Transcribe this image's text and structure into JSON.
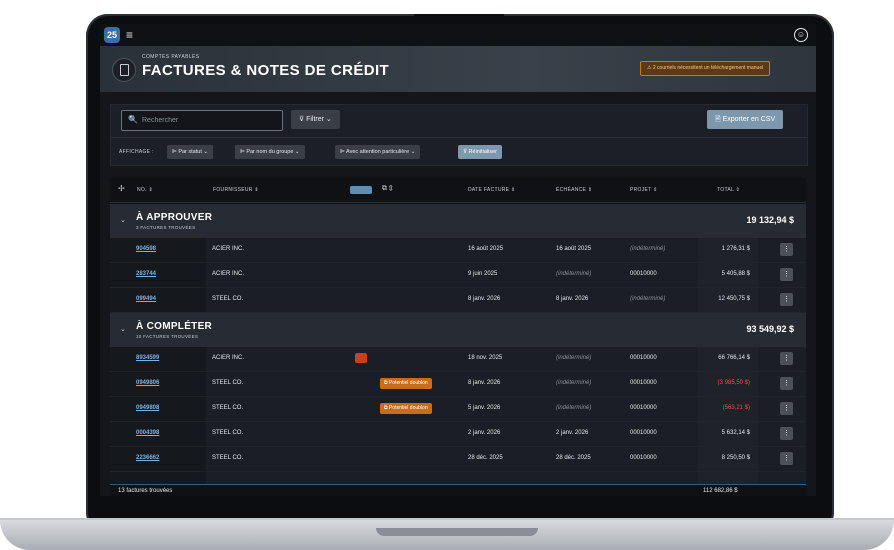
{
  "topbar": {
    "logo": "25",
    "hamburger": "≡",
    "user_icon": "☺"
  },
  "header": {
    "eyebrow": "COMPTES PAYABLES",
    "title": "FACTURES & NOTES DE CRÉDIT",
    "alert": "⚠ 2 courriels nécessitent un téléchargement manuel"
  },
  "toolbar": {
    "search_placeholder": "Rechercher",
    "search_icon": "🔍",
    "filter_label": "Filtrer",
    "filter_icon": "⊽",
    "export_label": "Exporter en CSV",
    "export_icon": "🗎",
    "affichage_label": "AFFICHAGE :",
    "chips": [
      "⊫ Par statut ⌄",
      "⊫ Par nom du groupe ⌄",
      "⊫ Avec attention particulière ⌄",
      "⊽ Réinitialiser"
    ]
  },
  "columns": {
    "add": "✢",
    "no": "NO. ⇕",
    "fournisseur": "FOURNISSEUR ⇕",
    "copy": "⧉ ⇕",
    "date": "DATE FACTURE ⇕",
    "echeance": "ÉCHÉANCE ⇕",
    "projet": "PROJET ⇕",
    "total": "TOTAL ⇕"
  },
  "groups": [
    {
      "chevron": "⌄",
      "title": "À APPROUVER",
      "sub": "3 FACTURES TROUVÉES",
      "total": "19 132,94 $",
      "rows": [
        {
          "no": "904598",
          "fournisseur": "ACIER INC.",
          "date": "16 août 2025",
          "echeance": "16 août 2025",
          "projet": "(indéterminé)",
          "total": "1 276,31 $"
        },
        {
          "no": "283744",
          "fournisseur": "ACIER INC.",
          "date": "9 juin 2025",
          "echeance": "(indéterminé)",
          "projet": "00010000",
          "total": "5 405,88 $"
        },
        {
          "no": "099494",
          "fournisseur": "STEEL CO.",
          "date": "8 janv. 2026",
          "echeance": "8 janv. 2026",
          "projet": "(indéterminé)",
          "total": "12 450,75 $"
        }
      ]
    },
    {
      "chevron": "⌄",
      "title": "À COMPLÉTER",
      "sub": "10 FACTURES TROUVÉES",
      "total": "93 549,92 $",
      "rows": [
        {
          "no": "8934599",
          "fournisseur": "ACIER INC.",
          "date": "18 nov. 2025",
          "echeance": "(indéterminé)",
          "projet": "00010000",
          "total": "66 766,14 $"
        },
        {
          "no": "0949806",
          "fournisseur": "STEEL CO.",
          "badge": "⧉ Potentiel doublon",
          "date": "8 janv. 2026",
          "echeance": "(indéterminé)",
          "projet": "00010000",
          "total": "(3 985,50 $)"
        },
        {
          "no": "0949808",
          "fournisseur": "STEEL CO.",
          "badge": "⧉ Potentiel doublon",
          "date": "5 janv. 2026",
          "echeance": "(indéterminé)",
          "projet": "00010000",
          "total": "(563,21 $)"
        },
        {
          "no": "0004398",
          "fournisseur": "STEEL CO.",
          "date": "2 janv. 2026",
          "echeance": "2 janv. 2026",
          "projet": "00010000",
          "total": "5 632,14 $"
        },
        {
          "no": "2236662",
          "fournisseur": "STEEL CO.",
          "date": "28 déc. 2025",
          "echeance": "28 déc. 2025",
          "projet": "00010000",
          "total": "8 250,50 $"
        }
      ]
    }
  ],
  "row_menu": "⋮",
  "footer": {
    "count": "13 factures trouvées",
    "total": "112 682,86 $"
  },
  "colors": {
    "accent": "#7d98ad",
    "link": "#7fb0e0",
    "negative": "#e0544e",
    "warning": "#c96d1a",
    "flag": "#c8401e"
  }
}
